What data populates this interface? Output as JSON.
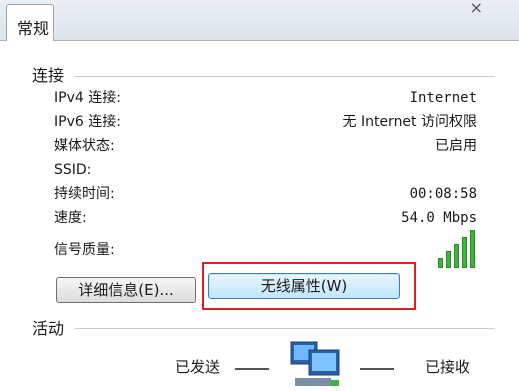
{
  "tab": {
    "label": "常规"
  },
  "connection": {
    "title": "连接",
    "rows": [
      {
        "label": "IPv4 连接:",
        "value": "Internet"
      },
      {
        "label": "IPv6 连接:",
        "value": "无 Internet 访问权限"
      },
      {
        "label": "媒体状态:",
        "value": "已启用"
      },
      {
        "label": "SSID:",
        "value": ""
      },
      {
        "label": "持续时间:",
        "value": "00:08:58"
      },
      {
        "label": "速度:",
        "value": "54.0 Mbps"
      }
    ],
    "signal_label": "信号质量:",
    "signal_level": 5,
    "signal_max": 5
  },
  "buttons": {
    "details": "详细信息(E)...",
    "wireless": "无线属性(W)"
  },
  "activity": {
    "title": "活动",
    "sent_label": "已发送",
    "received_label": "已接收"
  },
  "colors": {
    "signal_green": "#3fb43f",
    "highlight_red": "#e02020"
  },
  "icons": {
    "signal": "signal-strength-icon",
    "computer": "network-computer-icon",
    "close": "close-icon"
  }
}
